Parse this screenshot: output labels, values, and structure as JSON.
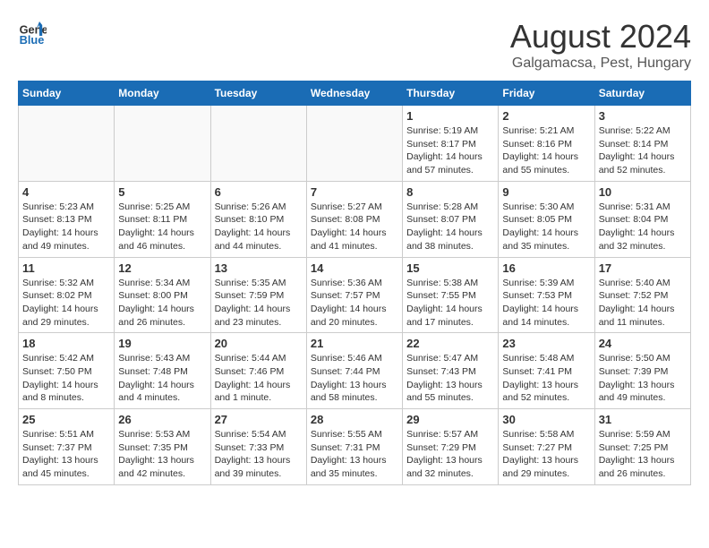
{
  "header": {
    "logo_line1": "General",
    "logo_line2": "Blue",
    "month_year": "August 2024",
    "location": "Galgamacsa, Pest, Hungary"
  },
  "days_of_week": [
    "Sunday",
    "Monday",
    "Tuesday",
    "Wednesday",
    "Thursday",
    "Friday",
    "Saturday"
  ],
  "weeks": [
    [
      {
        "day": "",
        "info": ""
      },
      {
        "day": "",
        "info": ""
      },
      {
        "day": "",
        "info": ""
      },
      {
        "day": "",
        "info": ""
      },
      {
        "day": "1",
        "info": "Sunrise: 5:19 AM\nSunset: 8:17 PM\nDaylight: 14 hours\nand 57 minutes."
      },
      {
        "day": "2",
        "info": "Sunrise: 5:21 AM\nSunset: 8:16 PM\nDaylight: 14 hours\nand 55 minutes."
      },
      {
        "day": "3",
        "info": "Sunrise: 5:22 AM\nSunset: 8:14 PM\nDaylight: 14 hours\nand 52 minutes."
      }
    ],
    [
      {
        "day": "4",
        "info": "Sunrise: 5:23 AM\nSunset: 8:13 PM\nDaylight: 14 hours\nand 49 minutes."
      },
      {
        "day": "5",
        "info": "Sunrise: 5:25 AM\nSunset: 8:11 PM\nDaylight: 14 hours\nand 46 minutes."
      },
      {
        "day": "6",
        "info": "Sunrise: 5:26 AM\nSunset: 8:10 PM\nDaylight: 14 hours\nand 44 minutes."
      },
      {
        "day": "7",
        "info": "Sunrise: 5:27 AM\nSunset: 8:08 PM\nDaylight: 14 hours\nand 41 minutes."
      },
      {
        "day": "8",
        "info": "Sunrise: 5:28 AM\nSunset: 8:07 PM\nDaylight: 14 hours\nand 38 minutes."
      },
      {
        "day": "9",
        "info": "Sunrise: 5:30 AM\nSunset: 8:05 PM\nDaylight: 14 hours\nand 35 minutes."
      },
      {
        "day": "10",
        "info": "Sunrise: 5:31 AM\nSunset: 8:04 PM\nDaylight: 14 hours\nand 32 minutes."
      }
    ],
    [
      {
        "day": "11",
        "info": "Sunrise: 5:32 AM\nSunset: 8:02 PM\nDaylight: 14 hours\nand 29 minutes."
      },
      {
        "day": "12",
        "info": "Sunrise: 5:34 AM\nSunset: 8:00 PM\nDaylight: 14 hours\nand 26 minutes."
      },
      {
        "day": "13",
        "info": "Sunrise: 5:35 AM\nSunset: 7:59 PM\nDaylight: 14 hours\nand 23 minutes."
      },
      {
        "day": "14",
        "info": "Sunrise: 5:36 AM\nSunset: 7:57 PM\nDaylight: 14 hours\nand 20 minutes."
      },
      {
        "day": "15",
        "info": "Sunrise: 5:38 AM\nSunset: 7:55 PM\nDaylight: 14 hours\nand 17 minutes."
      },
      {
        "day": "16",
        "info": "Sunrise: 5:39 AM\nSunset: 7:53 PM\nDaylight: 14 hours\nand 14 minutes."
      },
      {
        "day": "17",
        "info": "Sunrise: 5:40 AM\nSunset: 7:52 PM\nDaylight: 14 hours\nand 11 minutes."
      }
    ],
    [
      {
        "day": "18",
        "info": "Sunrise: 5:42 AM\nSunset: 7:50 PM\nDaylight: 14 hours\nand 8 minutes."
      },
      {
        "day": "19",
        "info": "Sunrise: 5:43 AM\nSunset: 7:48 PM\nDaylight: 14 hours\nand 4 minutes."
      },
      {
        "day": "20",
        "info": "Sunrise: 5:44 AM\nSunset: 7:46 PM\nDaylight: 14 hours\nand 1 minute."
      },
      {
        "day": "21",
        "info": "Sunrise: 5:46 AM\nSunset: 7:44 PM\nDaylight: 13 hours\nand 58 minutes."
      },
      {
        "day": "22",
        "info": "Sunrise: 5:47 AM\nSunset: 7:43 PM\nDaylight: 13 hours\nand 55 minutes."
      },
      {
        "day": "23",
        "info": "Sunrise: 5:48 AM\nSunset: 7:41 PM\nDaylight: 13 hours\nand 52 minutes."
      },
      {
        "day": "24",
        "info": "Sunrise: 5:50 AM\nSunset: 7:39 PM\nDaylight: 13 hours\nand 49 minutes."
      }
    ],
    [
      {
        "day": "25",
        "info": "Sunrise: 5:51 AM\nSunset: 7:37 PM\nDaylight: 13 hours\nand 45 minutes."
      },
      {
        "day": "26",
        "info": "Sunrise: 5:53 AM\nSunset: 7:35 PM\nDaylight: 13 hours\nand 42 minutes."
      },
      {
        "day": "27",
        "info": "Sunrise: 5:54 AM\nSunset: 7:33 PM\nDaylight: 13 hours\nand 39 minutes."
      },
      {
        "day": "28",
        "info": "Sunrise: 5:55 AM\nSunset: 7:31 PM\nDaylight: 13 hours\nand 35 minutes."
      },
      {
        "day": "29",
        "info": "Sunrise: 5:57 AM\nSunset: 7:29 PM\nDaylight: 13 hours\nand 32 minutes."
      },
      {
        "day": "30",
        "info": "Sunrise: 5:58 AM\nSunset: 7:27 PM\nDaylight: 13 hours\nand 29 minutes."
      },
      {
        "day": "31",
        "info": "Sunrise: 5:59 AM\nSunset: 7:25 PM\nDaylight: 13 hours\nand 26 minutes."
      }
    ]
  ]
}
